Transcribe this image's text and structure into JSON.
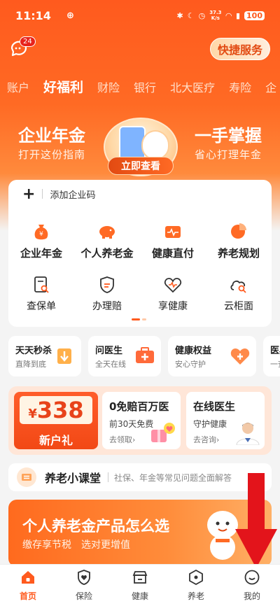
{
  "status_bar": {
    "time": "11:14",
    "app_icon": "ear-icon",
    "net_speed_value": "37.3",
    "net_speed_unit": "K/s",
    "battery": "100"
  },
  "header": {
    "messages_badge": "24",
    "quick_service_label": "快捷服务"
  },
  "tabs": [
    {
      "label": "账户"
    },
    {
      "label": "好福利",
      "active": true
    },
    {
      "label": "财险"
    },
    {
      "label": "银行"
    },
    {
      "label": "北大医疗"
    },
    {
      "label": "寿险"
    },
    {
      "label": "企"
    }
  ],
  "banner": {
    "left_title": "企业年金",
    "left_sub": "打开这份指南",
    "right_title": "一手掌握",
    "right_sub": "省心打理年金",
    "button_label": "立即查看"
  },
  "main_card": {
    "add_code_label": "添加企业码",
    "row1": [
      {
        "label": "企业年金",
        "icon": "money-bag-icon"
      },
      {
        "label": "个人养老金",
        "icon": "piggy-bank-icon"
      },
      {
        "label": "健康直付",
        "icon": "medical-wallet-icon"
      },
      {
        "label": "养老规划",
        "icon": "pie-chart-icon"
      }
    ],
    "row2": [
      {
        "label": "查保单",
        "icon": "policy-search-icon"
      },
      {
        "label": "办理赔",
        "icon": "shield-claim-icon"
      },
      {
        "label": "享健康",
        "icon": "heart-pulse-icon"
      },
      {
        "label": "云柜面",
        "icon": "cloud-search-icon"
      }
    ]
  },
  "mini_cards": [
    {
      "title": "天天秒杀",
      "sub": "直降到底",
      "icon": "coupon-arrow-icon"
    },
    {
      "title": "问医生",
      "sub": "全天在线",
      "icon": "medical-kit-icon"
    },
    {
      "title": "健康权益",
      "sub": "安心守护",
      "icon": "heart-shield-icon"
    },
    {
      "title": "医典",
      "sub": "一查"
    }
  ],
  "promo": {
    "coupon_currency": "¥",
    "coupon_amount": "338",
    "coupon_label": "新户礼",
    "card1": {
      "title": "0免赔百万医",
      "sub": "前30天免费",
      "link": "去领取›",
      "icon": "gift-heart-icon"
    },
    "card2": {
      "title": "在线医生",
      "sub": "守护健康",
      "link": "去咨询›",
      "icon": "doctor-avatar"
    }
  },
  "classroom": {
    "title": "养老小课堂",
    "sub": "社保、年金等常见问题全面解答"
  },
  "big_banner": {
    "title": "个人养老金产品怎么选",
    "sub": "缴存享节税　选对更增值"
  },
  "bottom_nav": [
    {
      "label": "首页",
      "icon": "home-icon",
      "active": true
    },
    {
      "label": "保险",
      "icon": "shield-heart-icon"
    },
    {
      "label": "健康",
      "icon": "store-icon"
    },
    {
      "label": "养老",
      "icon": "hexagon-icon"
    },
    {
      "label": "我的",
      "icon": "smile-icon"
    }
  ],
  "colors": {
    "brand": "#ff5a1e",
    "accent_red": "#e8231b",
    "annotation_arrow": "#e3141b"
  }
}
